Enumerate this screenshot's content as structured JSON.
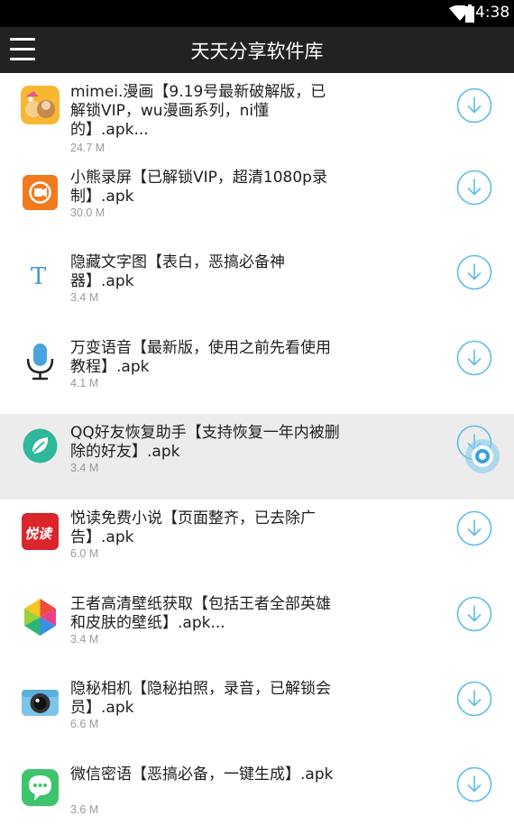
{
  "status_bar": {
    "time": "4:38"
  },
  "app_bar": {
    "title": "天天分享软件库"
  },
  "apps": [
    {
      "name": "mimei.漫画【9.19号最新破解版，已解锁VIP，wu漫画系列，ni懂的】.apk...",
      "size": "24.7 M",
      "icon": "comic-app-icon",
      "highlighted": false
    },
    {
      "name": "小熊录屏【已解锁VIP，超清1080p录制】.apk",
      "size": "30.0 M",
      "icon": "screen-recorder-icon",
      "highlighted": false
    },
    {
      "name": "隐藏文字图【表白，恶搞必备神器】.apk",
      "size": "3.4 M",
      "icon": "text-image-icon",
      "highlighted": false
    },
    {
      "name": "万变语音【最新版，使用之前先看使用教程】.apk",
      "size": "4.1 M",
      "icon": "microphone-icon",
      "highlighted": false
    },
    {
      "name": "QQ好友恢复助手【支持恢复一年内被删除的好友】.apk",
      "size": "3.4 M",
      "icon": "leaf-icon",
      "highlighted": true
    },
    {
      "name": "悦读免费小说【页面整齐，已去除广告】.apk",
      "size": "6.0 M",
      "icon": "novel-reader-icon",
      "highlighted": false
    },
    {
      "name": "王者高清壁纸获取【包括王者全部英雄和皮肤的壁纸】.apk...",
      "size": "3.4 M",
      "icon": "pinwheel-icon",
      "highlighted": false
    },
    {
      "name": "隐秘相机【隐秘拍照，录音，已解锁会员】.apk",
      "size": "6.6 M",
      "icon": "camera-icon",
      "highlighted": false
    },
    {
      "name": "微信密语【恶搞必备，一键生成】.apk",
      "size": "3.6 M",
      "icon": "chat-bubble-icon",
      "highlighted": false
    }
  ],
  "colors": {
    "accent": "#5bbde8",
    "status_bar": "#000000",
    "app_bar": "#222222",
    "highlight_row": "#ececec"
  }
}
